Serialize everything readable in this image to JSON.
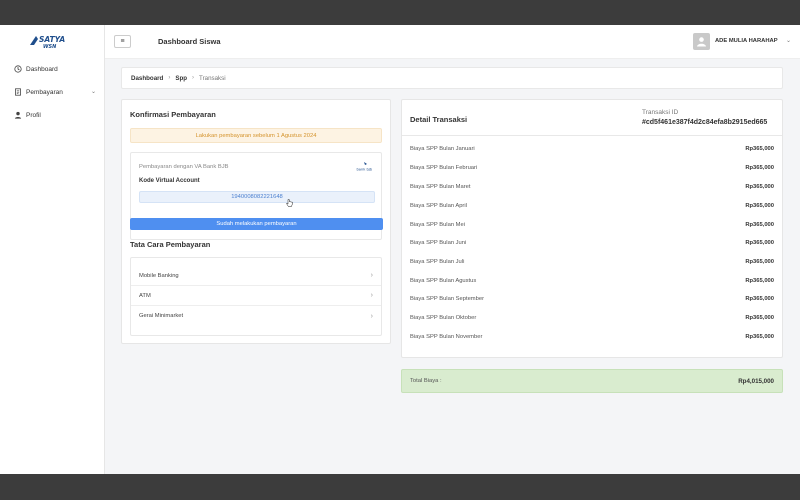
{
  "app": {
    "logo_text": "SATYA WSN",
    "page_title": "Dashboard Siswa"
  },
  "sidebar": {
    "items": [
      {
        "label": "Dashboard",
        "icon": "clock-icon"
      },
      {
        "label": "Pembayaran",
        "icon": "receipt-icon",
        "has_submenu": true
      },
      {
        "label": "Profil",
        "icon": "user-icon"
      }
    ]
  },
  "header": {
    "menu_toggle": "≡",
    "user_name": "ADE MULIA HARAHAP"
  },
  "breadcrumb": {
    "items": [
      "Dashboard",
      "Spp",
      "Transaksi"
    ]
  },
  "confirm": {
    "title": "Konfirmasi Pembayaran",
    "notice": "Lakukan pembayaran sebelum 1 Agustus 2024",
    "va_label": "Pembayaran dengan VA Bank BJB",
    "bank_logo_text": "bank bjb",
    "va_title": "Kode Virtual Account",
    "va_number": "1940008082221648",
    "paid_button": "Sudah melakukan pembayaran"
  },
  "guide": {
    "title": "Tata Cara Pembayaran",
    "steps": [
      "Mobile Banking",
      "ATM",
      "Gerai Minimarket"
    ]
  },
  "detail": {
    "title": "Detail Transaksi",
    "trx_label": "Transaksi ID",
    "trx_id": "#cd5f461e387f4d2c84efa8b2915ed665",
    "rows": [
      {
        "label": "Biaya SPP Bulan Januari",
        "amount": "Rp365,000"
      },
      {
        "label": "Biaya SPP Bulan Februari",
        "amount": "Rp365,000"
      },
      {
        "label": "Biaya SPP Bulan Maret",
        "amount": "Rp365,000"
      },
      {
        "label": "Biaya SPP Bulan April",
        "amount": "Rp365,000"
      },
      {
        "label": "Biaya SPP Bulan Mei",
        "amount": "Rp365,000"
      },
      {
        "label": "Biaya SPP Bulan Juni",
        "amount": "Rp365,000"
      },
      {
        "label": "Biaya SPP Bulan Juli",
        "amount": "Rp365,000"
      },
      {
        "label": "Biaya SPP Bulan Agustus",
        "amount": "Rp365,000"
      },
      {
        "label": "Biaya SPP Bulan September",
        "amount": "Rp365,000"
      },
      {
        "label": "Biaya SPP Bulan Oktober",
        "amount": "Rp365,000"
      },
      {
        "label": "Biaya SPP Bulan November",
        "amount": "Rp365,000"
      }
    ]
  },
  "total": {
    "label": "Total Biaya :",
    "amount": "Rp4,015,000"
  },
  "colors": {
    "accent": "#4f8ff0",
    "notice_text": "#d4932c",
    "total_bg": "#d9eccf"
  }
}
